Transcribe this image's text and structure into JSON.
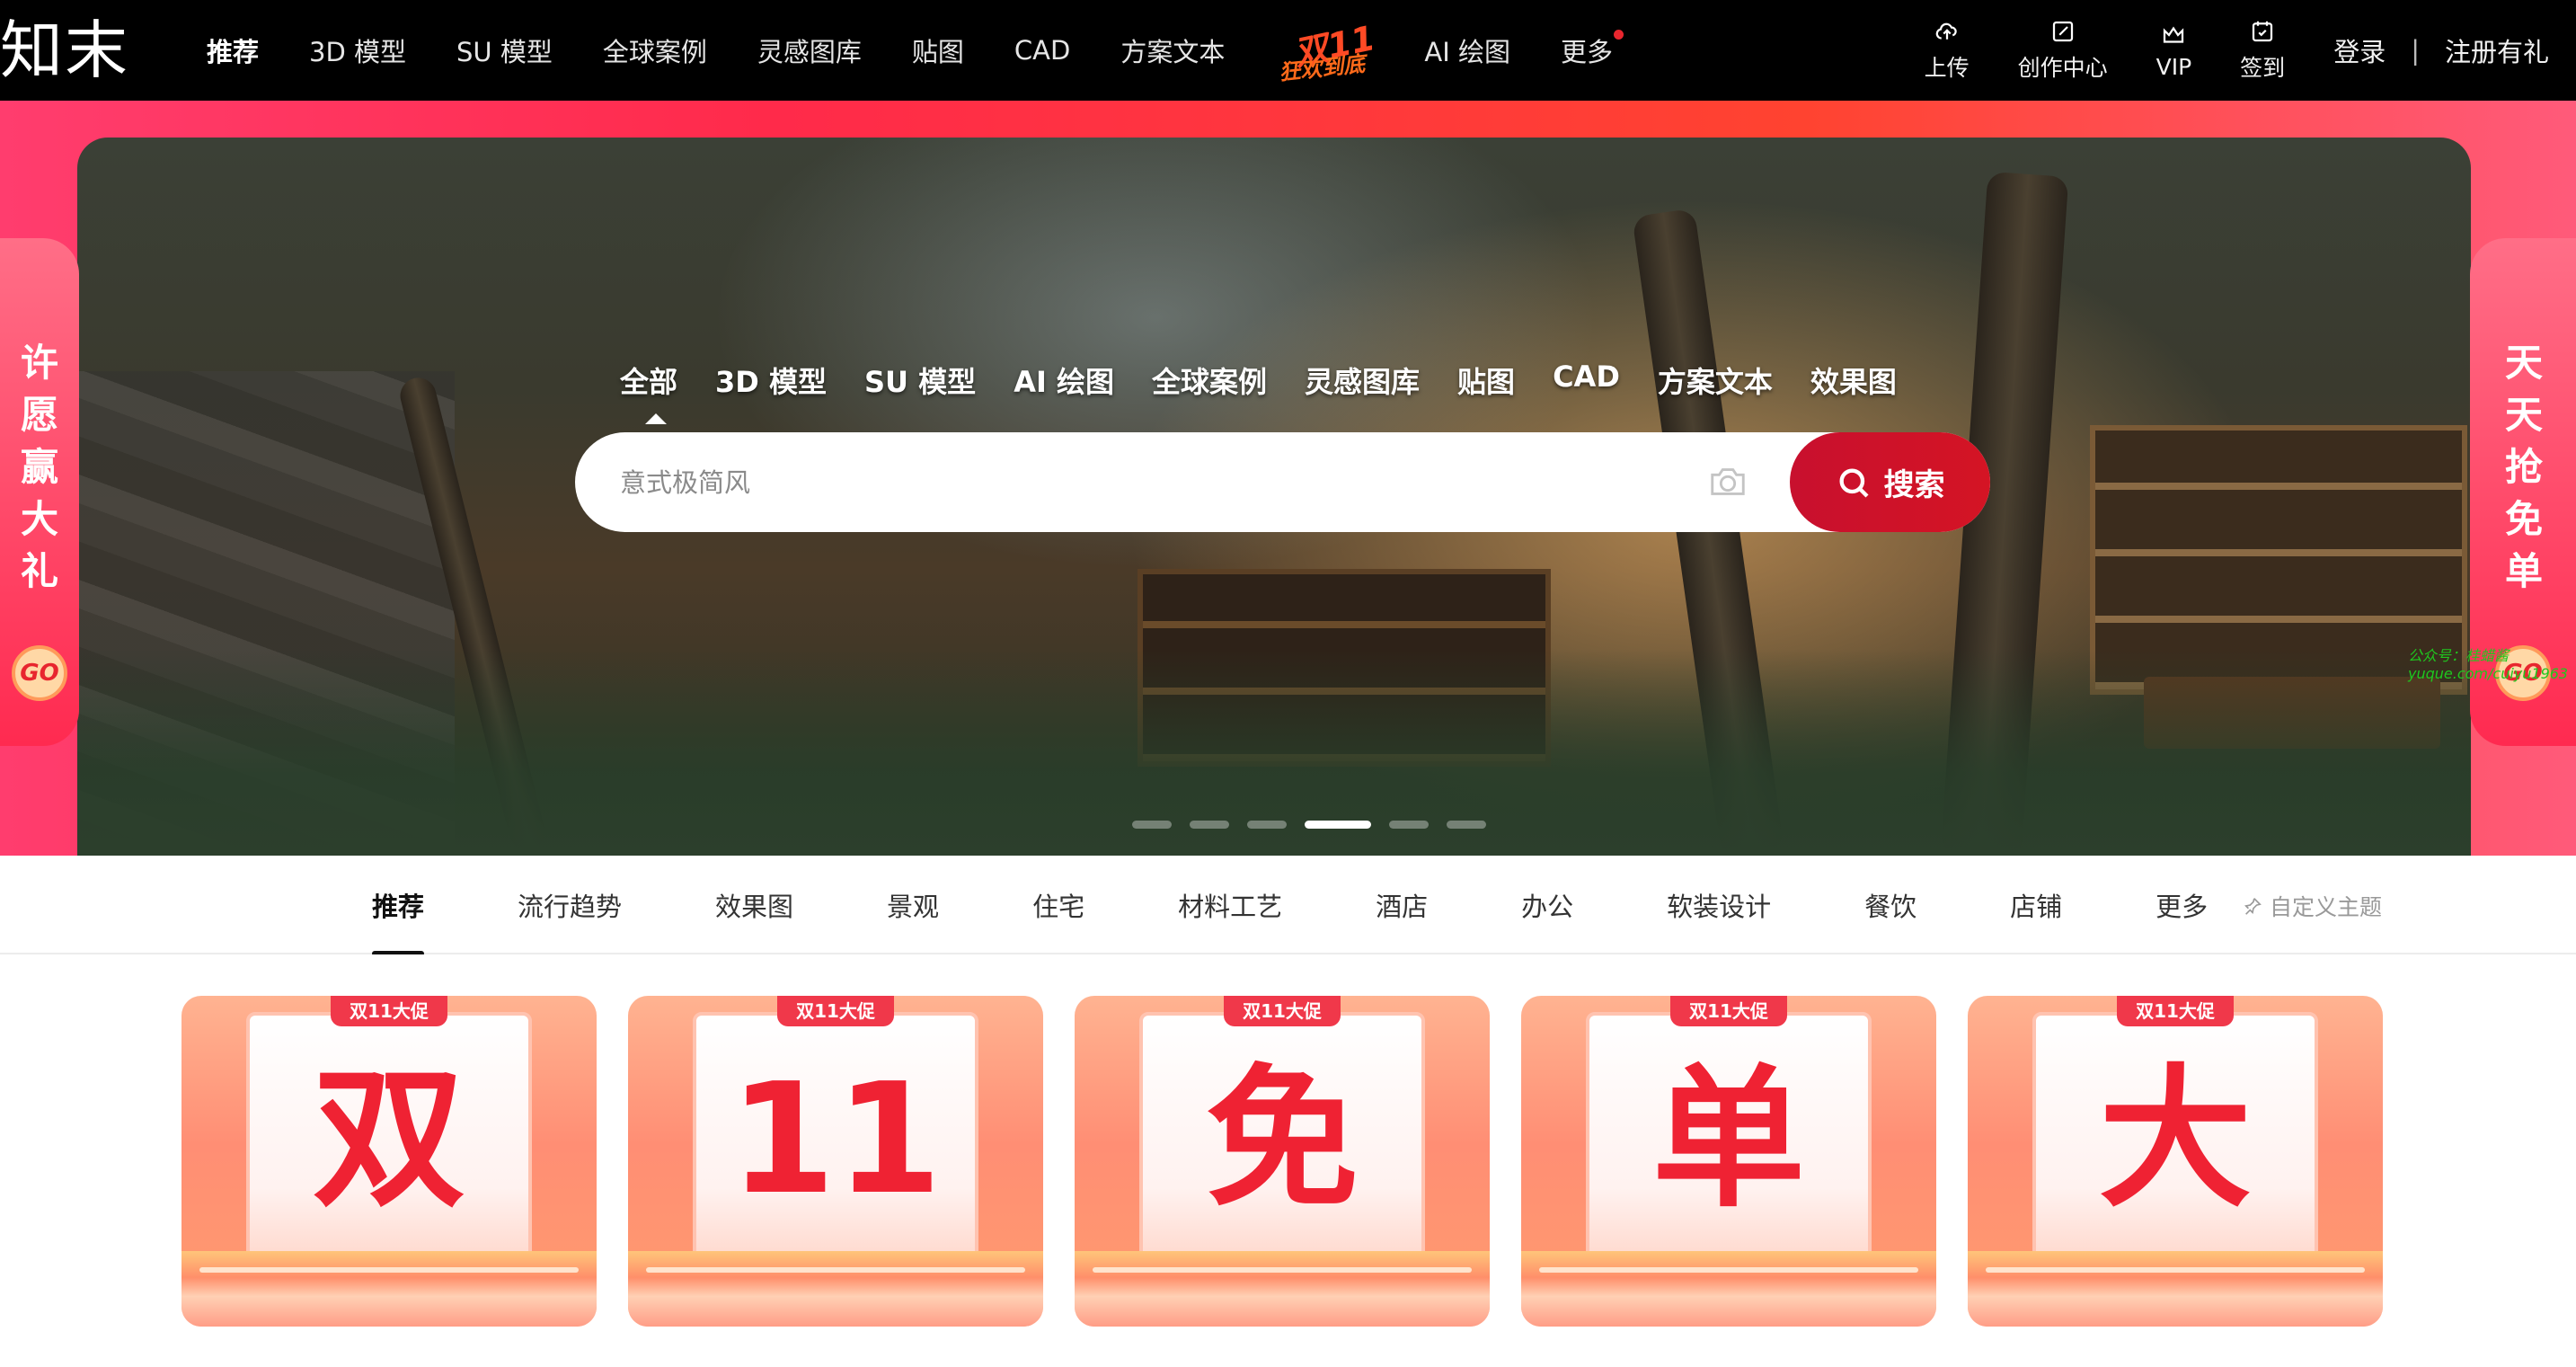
{
  "nav": {
    "logo": "知末",
    "items": [
      {
        "label": "推荐"
      },
      {
        "label": "3D 模型"
      },
      {
        "label": "SU 模型"
      },
      {
        "label": "全球案例"
      },
      {
        "label": "灵感图库"
      },
      {
        "label": "贴图"
      },
      {
        "label": "CAD"
      },
      {
        "label": "方案文本"
      },
      {
        "label": "AI 绘图"
      },
      {
        "label": "更多"
      }
    ],
    "promo": {
      "line1": "双11",
      "line2": "狂欢到底"
    },
    "tools": [
      {
        "label": "上传",
        "icon": "upload-cloud-icon"
      },
      {
        "label": "创作中心",
        "icon": "edit-icon"
      },
      {
        "label": "VIP",
        "icon": "crown-icon"
      },
      {
        "label": "签到",
        "icon": "checkin-icon"
      }
    ],
    "login": "登录",
    "separator": "|",
    "register": "注册有礼"
  },
  "hero": {
    "left_banner": "许愿赢大礼",
    "right_banner": "天天抢免单",
    "go": "GO",
    "watermark_line1": "公众号：桂蜡酱",
    "watermark_line2": "yuque.com/cuiyu1963",
    "search_categories": [
      {
        "label": "全部"
      },
      {
        "label": "3D 模型"
      },
      {
        "label": "SU 模型"
      },
      {
        "label": "AI 绘图"
      },
      {
        "label": "全球案例"
      },
      {
        "label": "灵感图库"
      },
      {
        "label": "贴图"
      },
      {
        "label": "CAD"
      },
      {
        "label": "方案文本"
      },
      {
        "label": "效果图"
      }
    ],
    "search_placeholder": "意式极简风",
    "search_button": "搜索",
    "carousel_count": 6,
    "carousel_active": 4
  },
  "tabs": {
    "items": [
      {
        "label": "推荐"
      },
      {
        "label": "流行趋势"
      },
      {
        "label": "效果图"
      },
      {
        "label": "景观"
      },
      {
        "label": "住宅"
      },
      {
        "label": "材料工艺"
      },
      {
        "label": "酒店"
      },
      {
        "label": "办公"
      },
      {
        "label": "软装设计"
      },
      {
        "label": "餐饮"
      },
      {
        "label": "店铺"
      },
      {
        "label": "更多"
      }
    ],
    "custom_theme": "自定义主题"
  },
  "cards": [
    {
      "tag": "双11大促",
      "char": "双"
    },
    {
      "tag": "双11大促",
      "char": "11"
    },
    {
      "tag": "双11大促",
      "char": "免"
    },
    {
      "tag": "双11大促",
      "char": "单"
    },
    {
      "tag": "双11大促",
      "char": "大"
    }
  ],
  "colors": {
    "brand_red": "#c8102e",
    "promo_pink": "#ff2a4a",
    "nav_bg": "#000000"
  }
}
